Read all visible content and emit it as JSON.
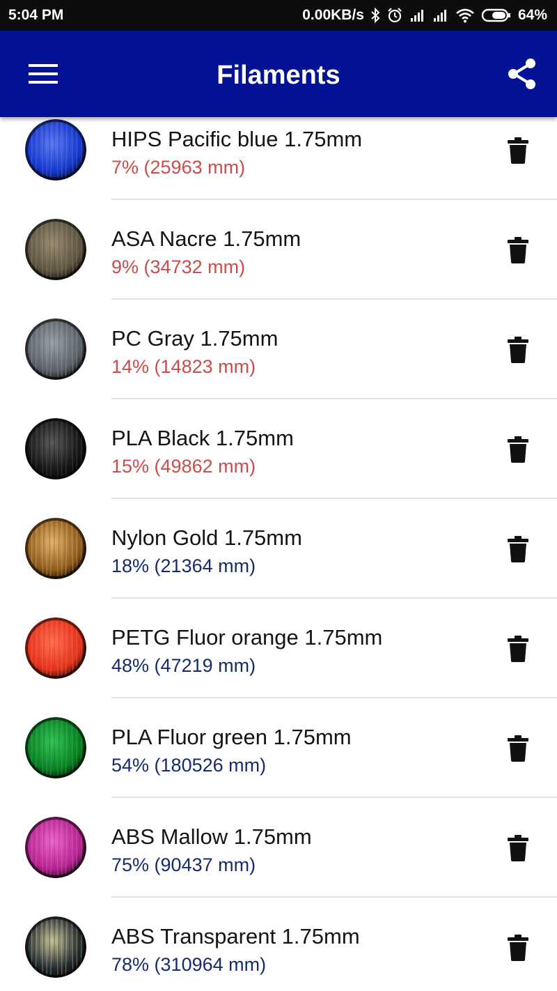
{
  "status_bar": {
    "time": "5:04 PM",
    "net_speed": "0.00KB/s",
    "battery": "64%",
    "icons": [
      "bluetooth-icon",
      "alarm-icon",
      "signal-icon",
      "signal-icon",
      "wifi-icon",
      "battery-icon"
    ]
  },
  "app_bar": {
    "title": "Filaments",
    "menu_icon": "hamburger-menu-icon",
    "share_icon": "share-icon",
    "color": "#041295"
  },
  "filaments": [
    {
      "name": "HIPS Pacific blue 1.75mm",
      "remaining": "7% (25963 mm)",
      "percent": 7,
      "low": true,
      "spool_color": "#1537c9",
      "thread_color": "#5f7cf0"
    },
    {
      "name": "ASA Nacre 1.75mm",
      "remaining": "9% (34732 mm)",
      "percent": 9,
      "low": true,
      "spool_color": "#5d5341",
      "thread_color": "#998d72"
    },
    {
      "name": "PC Gray 1.75mm",
      "remaining": "14% (14823 mm)",
      "percent": 14,
      "low": true,
      "spool_color": "#5a6066",
      "thread_color": "#9aa2aa"
    },
    {
      "name": "PLA Black 1.75mm",
      "remaining": "15% (49862 mm)",
      "percent": 15,
      "low": true,
      "spool_color": "#151515",
      "thread_color": "#5b5b5b"
    },
    {
      "name": "Nylon Gold 1.75mm",
      "remaining": "18% (21364 mm)",
      "percent": 18,
      "low": false,
      "spool_color": "#8c5a1c",
      "thread_color": "#e3b36a"
    },
    {
      "name": "PETG Fluor orange 1.75mm",
      "remaining": "48% (47219 mm)",
      "percent": 48,
      "low": false,
      "spool_color": "#e2321b",
      "thread_color": "#ff7052"
    },
    {
      "name": "PLA Fluor green 1.75mm",
      "remaining": "54% (180526 mm)",
      "percent": 54,
      "low": false,
      "spool_color": "#0b7d24",
      "thread_color": "#33c356"
    },
    {
      "name": "ABS Mallow 1.75mm",
      "remaining": "75% (90437 mm)",
      "percent": 75,
      "low": false,
      "spool_color": "#b3238f",
      "thread_color": "#e869c8"
    },
    {
      "name": "ABS Transparent 1.75mm",
      "remaining": "78% (310964 mm)",
      "percent": 78,
      "low": false,
      "spool_color": "#202a2e",
      "thread_color": "#c9c29a"
    }
  ],
  "colors": {
    "low_stock_text": "#cd4b4b",
    "ok_stock_text": "#142c6e"
  },
  "row_action_icon": "trash-icon"
}
